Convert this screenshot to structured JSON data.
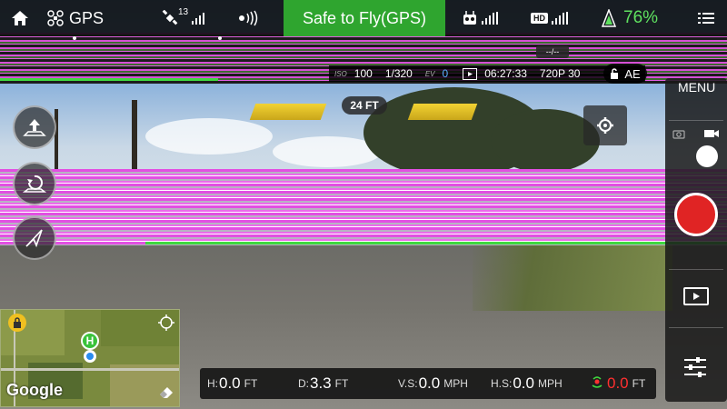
{
  "topbar": {
    "gps_label": "GPS",
    "satellite_count": "13",
    "status": "Safe to Fly(GPS)",
    "hd_label": "HD",
    "battery_percent": "76%"
  },
  "camera": {
    "iso_label": "ISO",
    "iso_value": "100",
    "shutter": "1/320",
    "ev_label": "EV",
    "ev_value": "0",
    "recording_time": "06:27:33",
    "resolution": "720P 30",
    "ae_label": "AE",
    "ev_dash": "--/--"
  },
  "altitude_indicator": "24 FT",
  "right_panel": {
    "menu_label": "MENU"
  },
  "map": {
    "home_label": "H",
    "logo_text": "Google"
  },
  "telemetry": {
    "h_label": "H:",
    "h_value": "0.0",
    "h_unit": "FT",
    "d_label": "D:",
    "d_value": "3.3",
    "d_unit": "FT",
    "vs_label": "V.S:",
    "vs_value": "0.0",
    "vs_unit": "MPH",
    "hs_label": "H.S:",
    "hs_value": "0.0",
    "hs_unit": "MPH",
    "home_dist_value": "0.0",
    "home_dist_unit": "FT"
  },
  "colors": {
    "status_green": "#2fa52f",
    "battery_green": "#5fe05f",
    "record_red": "#e02424",
    "warning_red": "#ff3030",
    "glitch_magenta": "#e24fe2"
  }
}
